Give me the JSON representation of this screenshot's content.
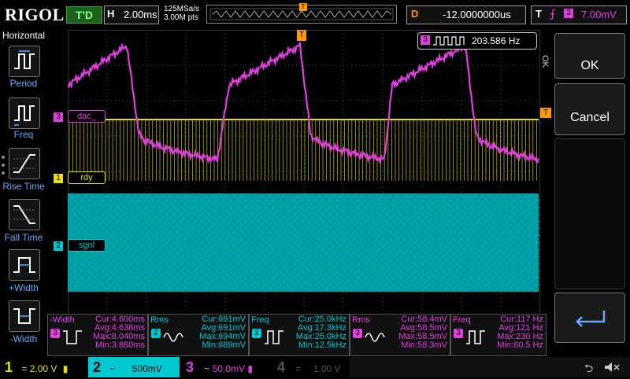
{
  "brand": "RIGOL",
  "top": {
    "trigger_status": "T'D",
    "timebase_label": "H",
    "timebase_value": "2.00ms",
    "sample_rate": "125MSa/s",
    "memory_depth": "3.00M pts",
    "delay_label": "D",
    "delay_value": "-12.0000000us",
    "trigger_label": "T",
    "trigger_source": "3",
    "trigger_level": "7.00mV"
  },
  "left_menu": {
    "title": "Horizontal",
    "items": [
      {
        "label": "Period",
        "icon": "period-icon"
      },
      {
        "label": "Freq",
        "icon": "freq-icon"
      },
      {
        "label": "Rise Time",
        "icon": "rise-time-icon"
      },
      {
        "label": "Fall Time",
        "icon": "fall-time-icon"
      },
      {
        "label": "+Width",
        "icon": "pos-width-icon"
      },
      {
        "label": "-Width",
        "icon": "neg-width-icon"
      }
    ]
  },
  "right_menu": {
    "side_label": "OK",
    "ok_label": "OK",
    "cancel_label": "Cancel"
  },
  "counter": {
    "channel": "3",
    "value": "203.586 Hz"
  },
  "waveforms": {
    "labels": [
      {
        "ch": "3",
        "name": "dac_"
      },
      {
        "ch": "1",
        "name": "rdy"
      },
      {
        "ch": "2",
        "name": "sgnl"
      }
    ],
    "colors": {
      "ch1": "#e8e000",
      "ch2": "#00c8d0",
      "ch3": "#e040e0",
      "ch4": "#5078ff"
    }
  },
  "measurements": [
    {
      "name": "-Width",
      "ch": "3",
      "icon": "neg-width-icon",
      "cur": "Cur:4.600ms",
      "avg": "Avg:4.638ms",
      "max": "Max:8.040ms",
      "min": "Min:3.880ms"
    },
    {
      "name": "Rms",
      "ch": "2",
      "icon": "rms-icon",
      "cur": "Cur:691mV",
      "avg": "Avg:691mV",
      "max": "Max:694mV",
      "min": "Min:689mV"
    },
    {
      "name": "Freq",
      "ch": "2",
      "icon": "freq-icon",
      "cur": "Cur:25.0kHz",
      "avg": "Avg:17.3kHz",
      "max": "Max:25.0kHz",
      "min": "Min:12.5kHz"
    },
    {
      "name": "Rms",
      "ch": "3",
      "icon": "rms-icon",
      "cur": "Cur:58.4mV",
      "avg": "Avg:58.5mV",
      "max": "Max:58.5mV",
      "min": "Min:58.3mV"
    },
    {
      "name": "Freq",
      "ch": "3",
      "icon": "freq-icon",
      "cur": "Cur:117 Hz",
      "avg": "Avg:121 Hz",
      "max": "Max:230 Hz",
      "min": "Min:60.5 Hz"
    }
  ],
  "channels": [
    {
      "num": "1",
      "coupling": "=",
      "scale": "2.00 V"
    },
    {
      "num": "2",
      "coupling": "~",
      "scale": "500mV"
    },
    {
      "num": "3",
      "coupling": "~",
      "scale": "50.0mV"
    },
    {
      "num": "4",
      "coupling": "=",
      "scale": "1.00 V"
    }
  ]
}
